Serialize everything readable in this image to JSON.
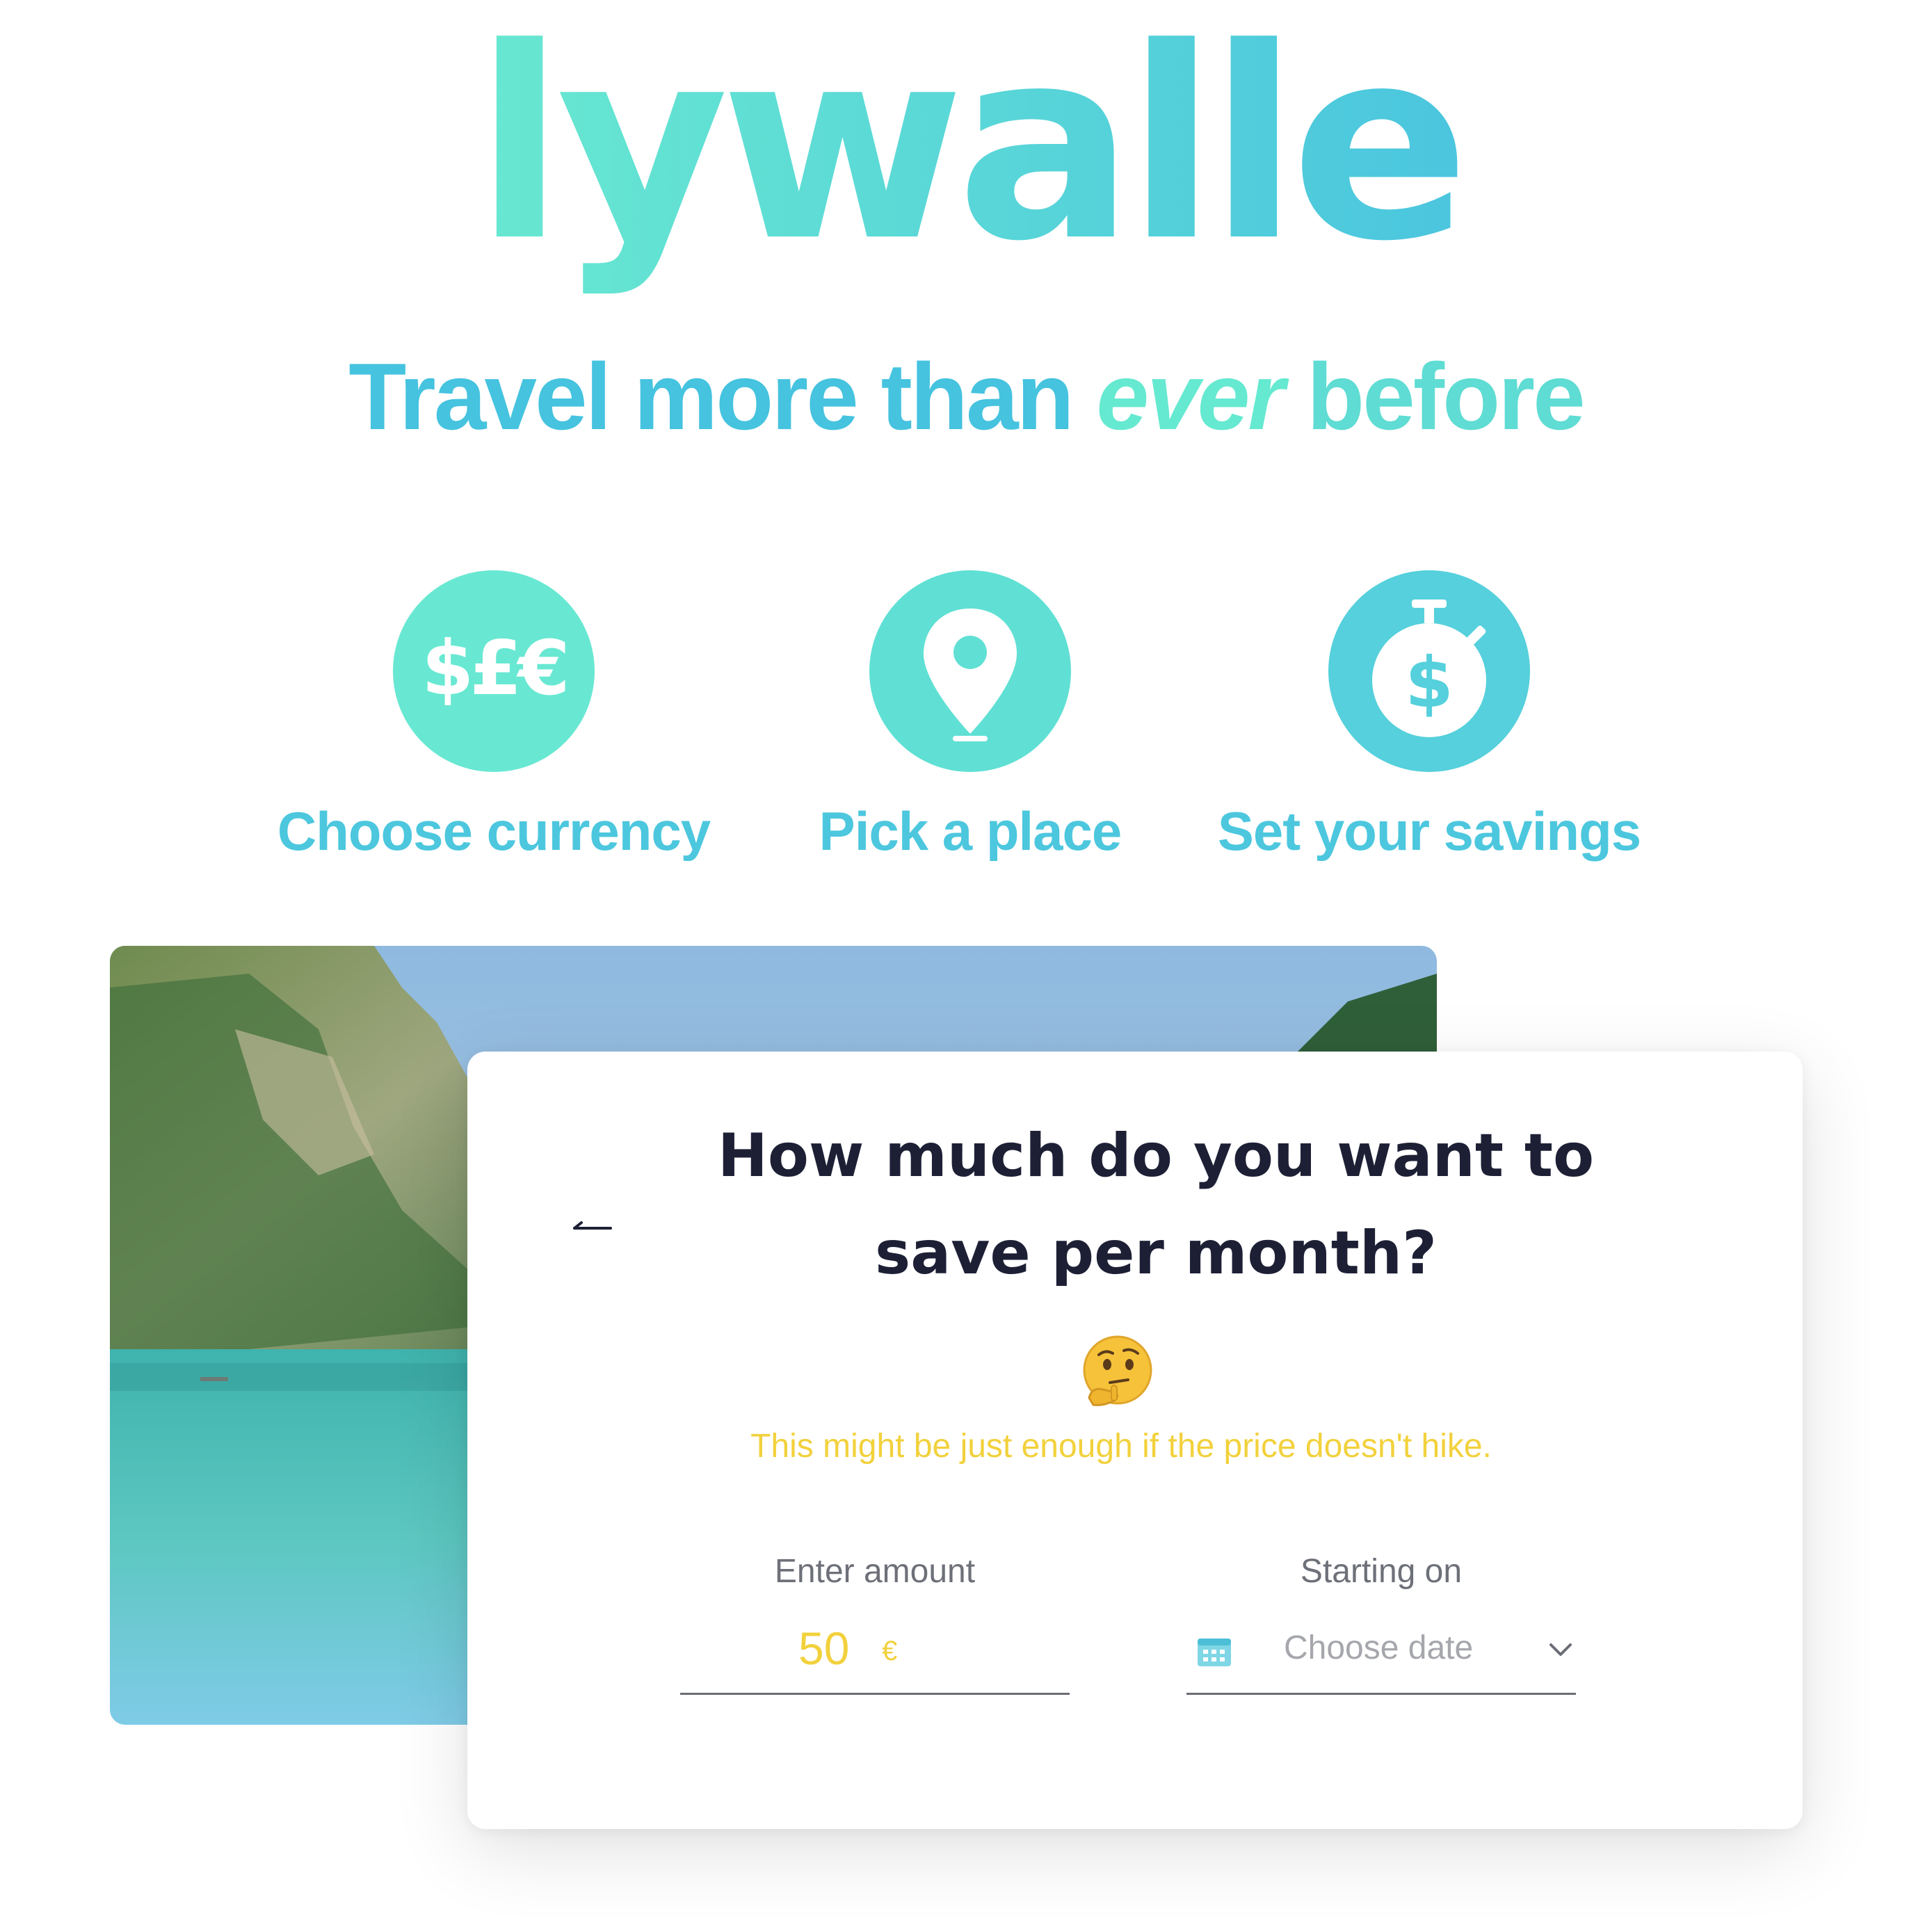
{
  "brand": {
    "logo_text": "flywallet",
    "gradient_start": "#6beccf",
    "gradient_end": "#47c1e0"
  },
  "tagline": {
    "part1": "Travel more than ",
    "part2": "ever",
    "part3": " before"
  },
  "steps": [
    {
      "icon": "currency-icon",
      "icon_text": "$£€",
      "label": "Choose currency"
    },
    {
      "icon": "location-pin-icon",
      "label": "Pick a place"
    },
    {
      "icon": "stopwatch-dollar-icon",
      "icon_text": "$",
      "label": "Set your savings"
    }
  ],
  "card": {
    "title": "How much do you want to save per month?",
    "emoji": "thinking-face-icon",
    "hint": "This might be just enough if the price doesn't hike.",
    "amount": {
      "label": "Enter amount",
      "value": "50",
      "unit": "€"
    },
    "date": {
      "label": "Starting on",
      "placeholder": "Choose date"
    }
  },
  "colors": {
    "accent_teal": "#66e9d1",
    "accent_blue": "#45c3df",
    "hint_yellow": "#f2d13c",
    "title_dark": "#1d2035"
  }
}
